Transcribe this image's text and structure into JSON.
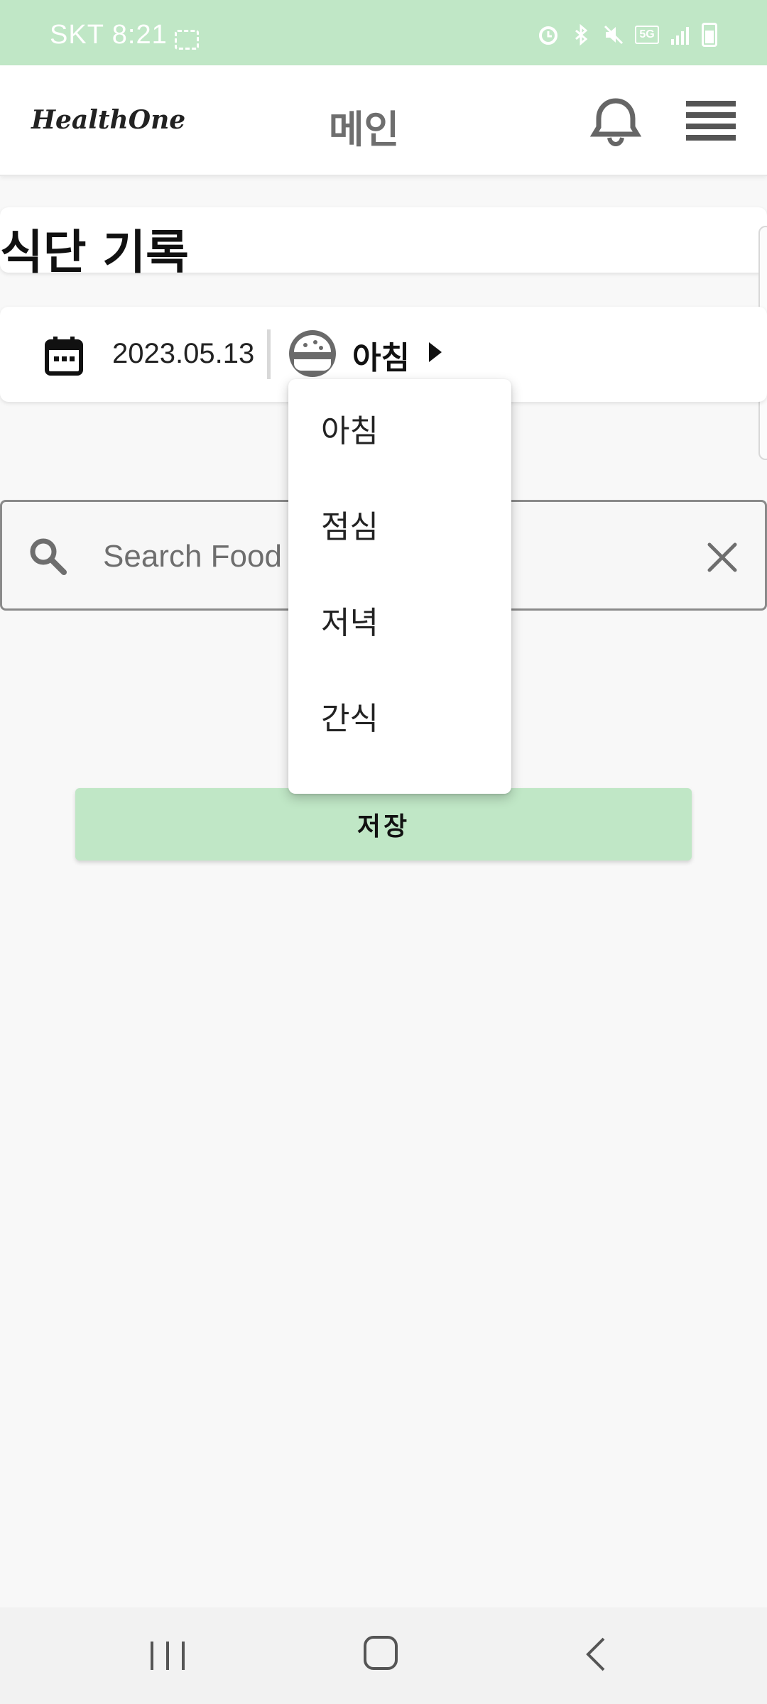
{
  "status_bar": {
    "carrier_time": "SKT 8:21",
    "network_label": "5G"
  },
  "header": {
    "logo": "HealthOne",
    "title": "메인"
  },
  "page": {
    "title": "식단 기록"
  },
  "meal_selector": {
    "date": "2023.05.13",
    "selected_meal": "아침"
  },
  "search": {
    "placeholder": "Search Food",
    "value": ""
  },
  "dropdown": {
    "options": [
      "아침",
      "점심",
      "저녁",
      "간식"
    ]
  },
  "actions": {
    "save_label": "저장"
  },
  "colors": {
    "accent_green": "#c0e7c6",
    "icon_gray": "#6e6e6e"
  }
}
